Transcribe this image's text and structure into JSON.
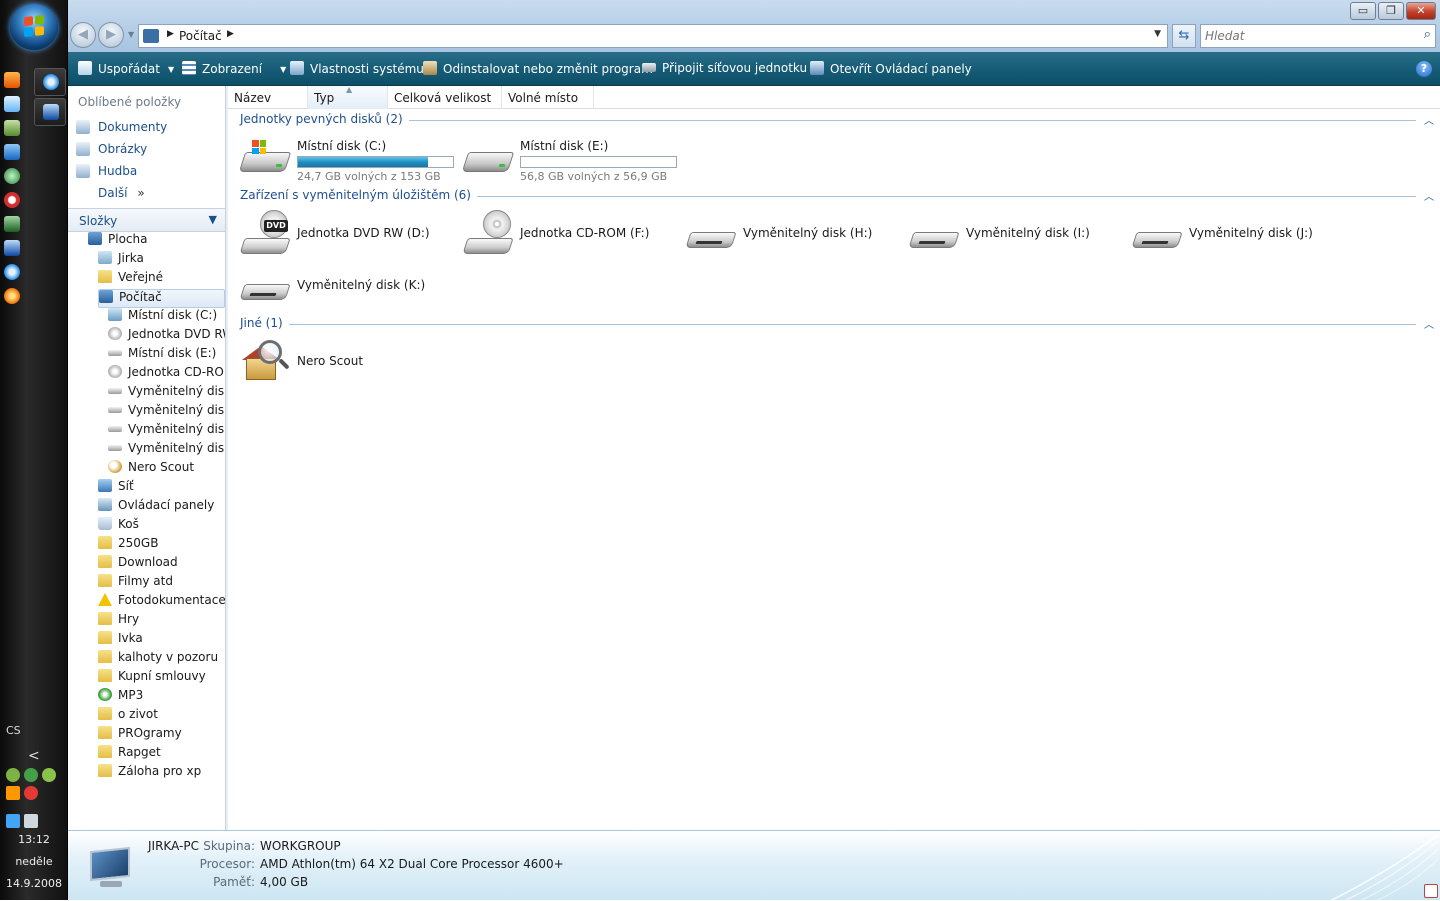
{
  "taskbar": {
    "language": "CS",
    "clock_time": "13:12",
    "clock_day": "neděle",
    "clock_date": "14.9.2008",
    "tray_expand": "<"
  },
  "window": {
    "title_breadcrumb": "Počítač",
    "search_placeholder": "Hledat",
    "controls": {
      "minimize": "▭",
      "maximize": "❐",
      "close": "✕"
    }
  },
  "toolbar": {
    "organize": "Uspořádat",
    "views": "Zobrazení",
    "system_properties": "Vlastnosti systému",
    "uninstall": "Odinstalovat nebo změnit program",
    "map_drive": "Připojit síťovou jednotku",
    "control_panel": "Otevřít Ovládací panely",
    "help": "?"
  },
  "navpane": {
    "favorites_title": "Oblíbené položky",
    "favorites": [
      "Dokumenty",
      "Obrázky",
      "Hudba"
    ],
    "more_label": "Další",
    "more_chevron": "»",
    "folders_title": "Složky",
    "tree": [
      {
        "label": "Plocha",
        "icon": "pc"
      },
      {
        "label": "Jirka",
        "icon": "user"
      },
      {
        "label": "Veřejné",
        "icon": "folder"
      },
      {
        "label": "Počítač",
        "icon": "pc"
      },
      {
        "label": "Místní disk (C:)",
        "icon": "disk"
      },
      {
        "label": "Jednotka DVD RW",
        "icon": "cd"
      },
      {
        "label": "Místní disk (E:)",
        "icon": "drive"
      },
      {
        "label": "Jednotka CD-ROM",
        "icon": "cd"
      },
      {
        "label": "Vyměnitelný disk",
        "icon": "drive"
      },
      {
        "label": "Vyměnitelný disk",
        "icon": "drive"
      },
      {
        "label": "Vyměnitelný disk",
        "icon": "drive"
      },
      {
        "label": "Vyměnitelný disk",
        "icon": "drive"
      },
      {
        "label": "Nero Scout",
        "icon": "nero"
      },
      {
        "label": "Síť",
        "icon": "net"
      },
      {
        "label": "Ovládací panely",
        "icon": "panel"
      },
      {
        "label": "Koš",
        "icon": "bin"
      },
      {
        "label": "250GB",
        "icon": "folder"
      },
      {
        "label": "Download",
        "icon": "folder"
      },
      {
        "label": "Filmy atd",
        "icon": "folder"
      },
      {
        "label": "Fotodokumentace",
        "icon": "warn"
      },
      {
        "label": "Hry",
        "icon": "folder"
      },
      {
        "label": "Ivka",
        "icon": "folder"
      },
      {
        "label": "kalhoty v pozoru",
        "icon": "folder"
      },
      {
        "label": "Kupní smlouvy",
        "icon": "folder"
      },
      {
        "label": "MP3",
        "icon": "mp3"
      },
      {
        "label": "o zivot",
        "icon": "folder"
      },
      {
        "label": "PROgramy",
        "icon": "folder"
      },
      {
        "label": "Rapget",
        "icon": "folder"
      },
      {
        "label": "Záloha pro xp",
        "icon": "folder"
      }
    ]
  },
  "columns": [
    "Název",
    "Typ",
    "Celková velikost",
    "Volné místo"
  ],
  "groups": {
    "hard_drives": {
      "title": "Jednotky pevných disků (2)",
      "items": [
        {
          "name": "Místní disk (C:)",
          "info": "24,7 GB volných z 153 GB",
          "used_fraction": 0.84
        },
        {
          "name": "Místní disk (E:)",
          "info": "56,8 GB volných z 56,9 GB",
          "used_fraction": 0.0
        }
      ]
    },
    "removable": {
      "title": "Zařízení s vyměnitelným úložištěm (6)",
      "items": [
        {
          "name": "Jednotka DVD RW (D:)"
        },
        {
          "name": "Jednotka CD-ROM (F:)"
        },
        {
          "name": "Vyměnitelný disk (H:)"
        },
        {
          "name": "Vyměnitelný disk (I:)"
        },
        {
          "name": "Vyměnitelný disk (J:)"
        },
        {
          "name": "Vyměnitelný disk (K:)"
        }
      ]
    },
    "other": {
      "title": "Jiné (1)",
      "items": [
        {
          "name": "Nero Scout"
        }
      ]
    }
  },
  "dvd_label": "DVD",
  "details": {
    "pc_name": "JIRKA-PC",
    "workgroup_label": "Skupina:",
    "workgroup_value": "WORKGROUP",
    "processor_label": "Procesor:",
    "processor_value": "AMD Athlon(tm) 64 X2 Dual Core Processor 4600+",
    "memory_label": "Paměť:",
    "memory_value": "4,00 GB"
  }
}
